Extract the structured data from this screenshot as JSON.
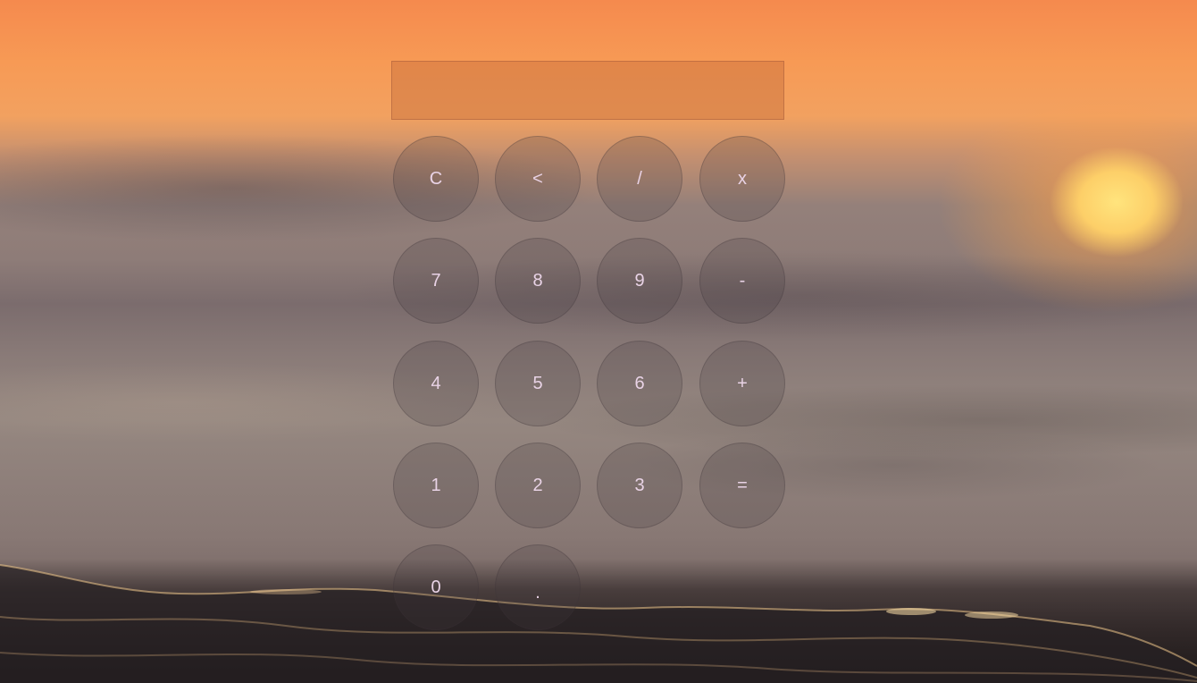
{
  "display": {
    "value": ""
  },
  "keypad": {
    "rows": [
      [
        {
          "name": "clear-button",
          "label": "C"
        },
        {
          "name": "backspace-button",
          "label": "<"
        },
        {
          "name": "divide-button",
          "label": "/"
        },
        {
          "name": "multiply-button",
          "label": "x"
        }
      ],
      [
        {
          "name": "digit-7-button",
          "label": "7"
        },
        {
          "name": "digit-8-button",
          "label": "8"
        },
        {
          "name": "digit-9-button",
          "label": "9"
        },
        {
          "name": "subtract-button",
          "label": "-"
        }
      ],
      [
        {
          "name": "digit-4-button",
          "label": "4"
        },
        {
          "name": "digit-5-button",
          "label": "5"
        },
        {
          "name": "digit-6-button",
          "label": "6"
        },
        {
          "name": "add-button",
          "label": "+"
        }
      ],
      [
        {
          "name": "digit-1-button",
          "label": "1"
        },
        {
          "name": "digit-2-button",
          "label": "2"
        },
        {
          "name": "digit-3-button",
          "label": "3"
        },
        {
          "name": "equals-button",
          "label": "="
        }
      ],
      [
        {
          "name": "digit-0-button",
          "label": "0"
        },
        {
          "name": "decimal-button",
          "label": "."
        }
      ]
    ]
  },
  "colors": {
    "key_text": "#e9d3e6",
    "sky_top": "#f58a4e",
    "sun": "#ffe47d"
  }
}
